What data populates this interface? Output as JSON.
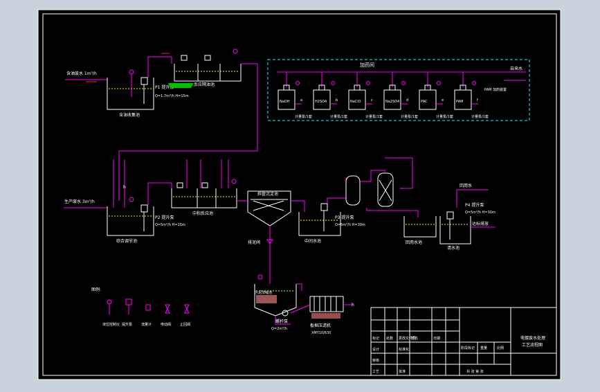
{
  "drawing": {
    "colors": {
      "background": "#000000",
      "outer_bg": "#c9d3dd",
      "pipe": "#ff00ff",
      "line": "#ffffff",
      "dashed_box": "#00ffff",
      "text": "#ffffff",
      "green_mark": "#00c000"
    },
    "process_labels": {
      "raw_water_in_1": "含油废水 1m³/h",
      "tank_1": "含油收集池",
      "pump_1": "P1 提升泵",
      "pump_1_spec": "Q=1.7m³/h H=15m",
      "reactor_1": "反应隔油池",
      "dosing_header": "加药间",
      "tap_water": "自来水",
      "dosing_note": "PAM 加药装置",
      "water_in_2": "生产废水 3m³/h",
      "tank_2": "综合调节池",
      "pump_2": "P2 提升泵",
      "pump_2_spec": "Q=5m³/h H=15m",
      "reactor_2": "中和反应池",
      "settler": "斜管沉淀池",
      "sludge_valve": "排泥阀",
      "mid_tank": "中间水池",
      "pump_3": "P3 提升泵",
      "pump_3_spec": "Q=5m³/h H=30m",
      "reuse_water": "回用水",
      "clean_tank": "清水池",
      "pump_4": "P4 提升泵",
      "pump_4_spec": "Q=5m³/h H=30m",
      "reuse_tank": "回用水池",
      "discharge": "达标排放",
      "sludge_tank": "污泥浓缩池",
      "sludge_pump": "螺杆泵",
      "sludge_pump_spec": "Q=2m³/h",
      "filter_press": "板框压滤机",
      "filter_press_spec": "XMY10/630",
      "h_mark": "h"
    },
    "dosing_tanks": [
      {
        "name": "NaOH",
        "tag": "a",
        "pump": "计量泵/1套"
      },
      {
        "name": "H2SO4",
        "tag": "b",
        "pump": "计量泵/1套"
      },
      {
        "name": "NaClO",
        "tag": "c",
        "pump": "计量泵/1套"
      },
      {
        "name": "Na2SO4",
        "tag": "d",
        "pump": "计量泵/1套"
      },
      {
        "name": "PAC",
        "tag": "e",
        "pump": "计量泵/1套"
      },
      {
        "name": "PAM",
        "tag": "f",
        "pump": "计量泵/1套"
      }
    ],
    "legend": {
      "title": "图例:",
      "items": [
        "液位控制仪",
        "提升泵",
        "流量计",
        "电动阀",
        "止回阀"
      ]
    },
    "title_block": {
      "drawing_title_1": "电镀废水处理",
      "drawing_title_2": "工艺流程图",
      "rows": [
        [
          "标记",
          "处数",
          "更改文件号",
          "签名",
          "日期"
        ],
        [
          "设计",
          "",
          "标准化",
          "",
          ""
        ],
        [
          "审核",
          "",
          "",
          "",
          ""
        ],
        [
          "工艺",
          "",
          "批准",
          "",
          ""
        ]
      ],
      "stage_label": "阶段标记",
      "weight_label": "重量",
      "scale_label": "比例",
      "sheet_label": "共 张 第 张"
    }
  }
}
